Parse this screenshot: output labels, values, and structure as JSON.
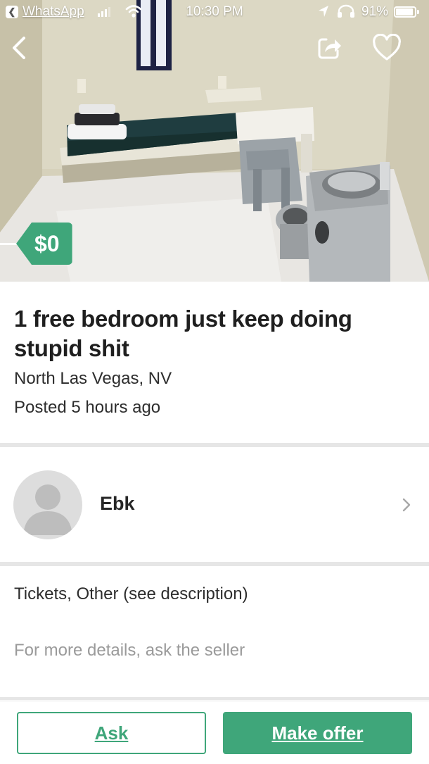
{
  "status_bar": {
    "back_app": "WhatsApp",
    "time": "10:30 PM",
    "battery_pct": "91%",
    "battery_level": 0.91
  },
  "hero": {
    "image_subject": "jail cell",
    "price": "$0",
    "icons": [
      "back-chevron-icon",
      "share-icon",
      "heart-icon"
    ]
  },
  "listing": {
    "title": "1 free bedroom just keep doing stupid shit",
    "location": "North Las Vegas, NV",
    "posted": "Posted 5 hours ago",
    "category": "Tickets, Other (see description)",
    "more_details": "For more details, ask the seller"
  },
  "seller": {
    "name": "Ebk"
  },
  "actions": {
    "ask_label": "Ask",
    "offer_label": "Make offer"
  },
  "colors": {
    "accent": "#3fa67a",
    "divider": "#e6e6e6",
    "muted_text": "#9a9a9a"
  }
}
